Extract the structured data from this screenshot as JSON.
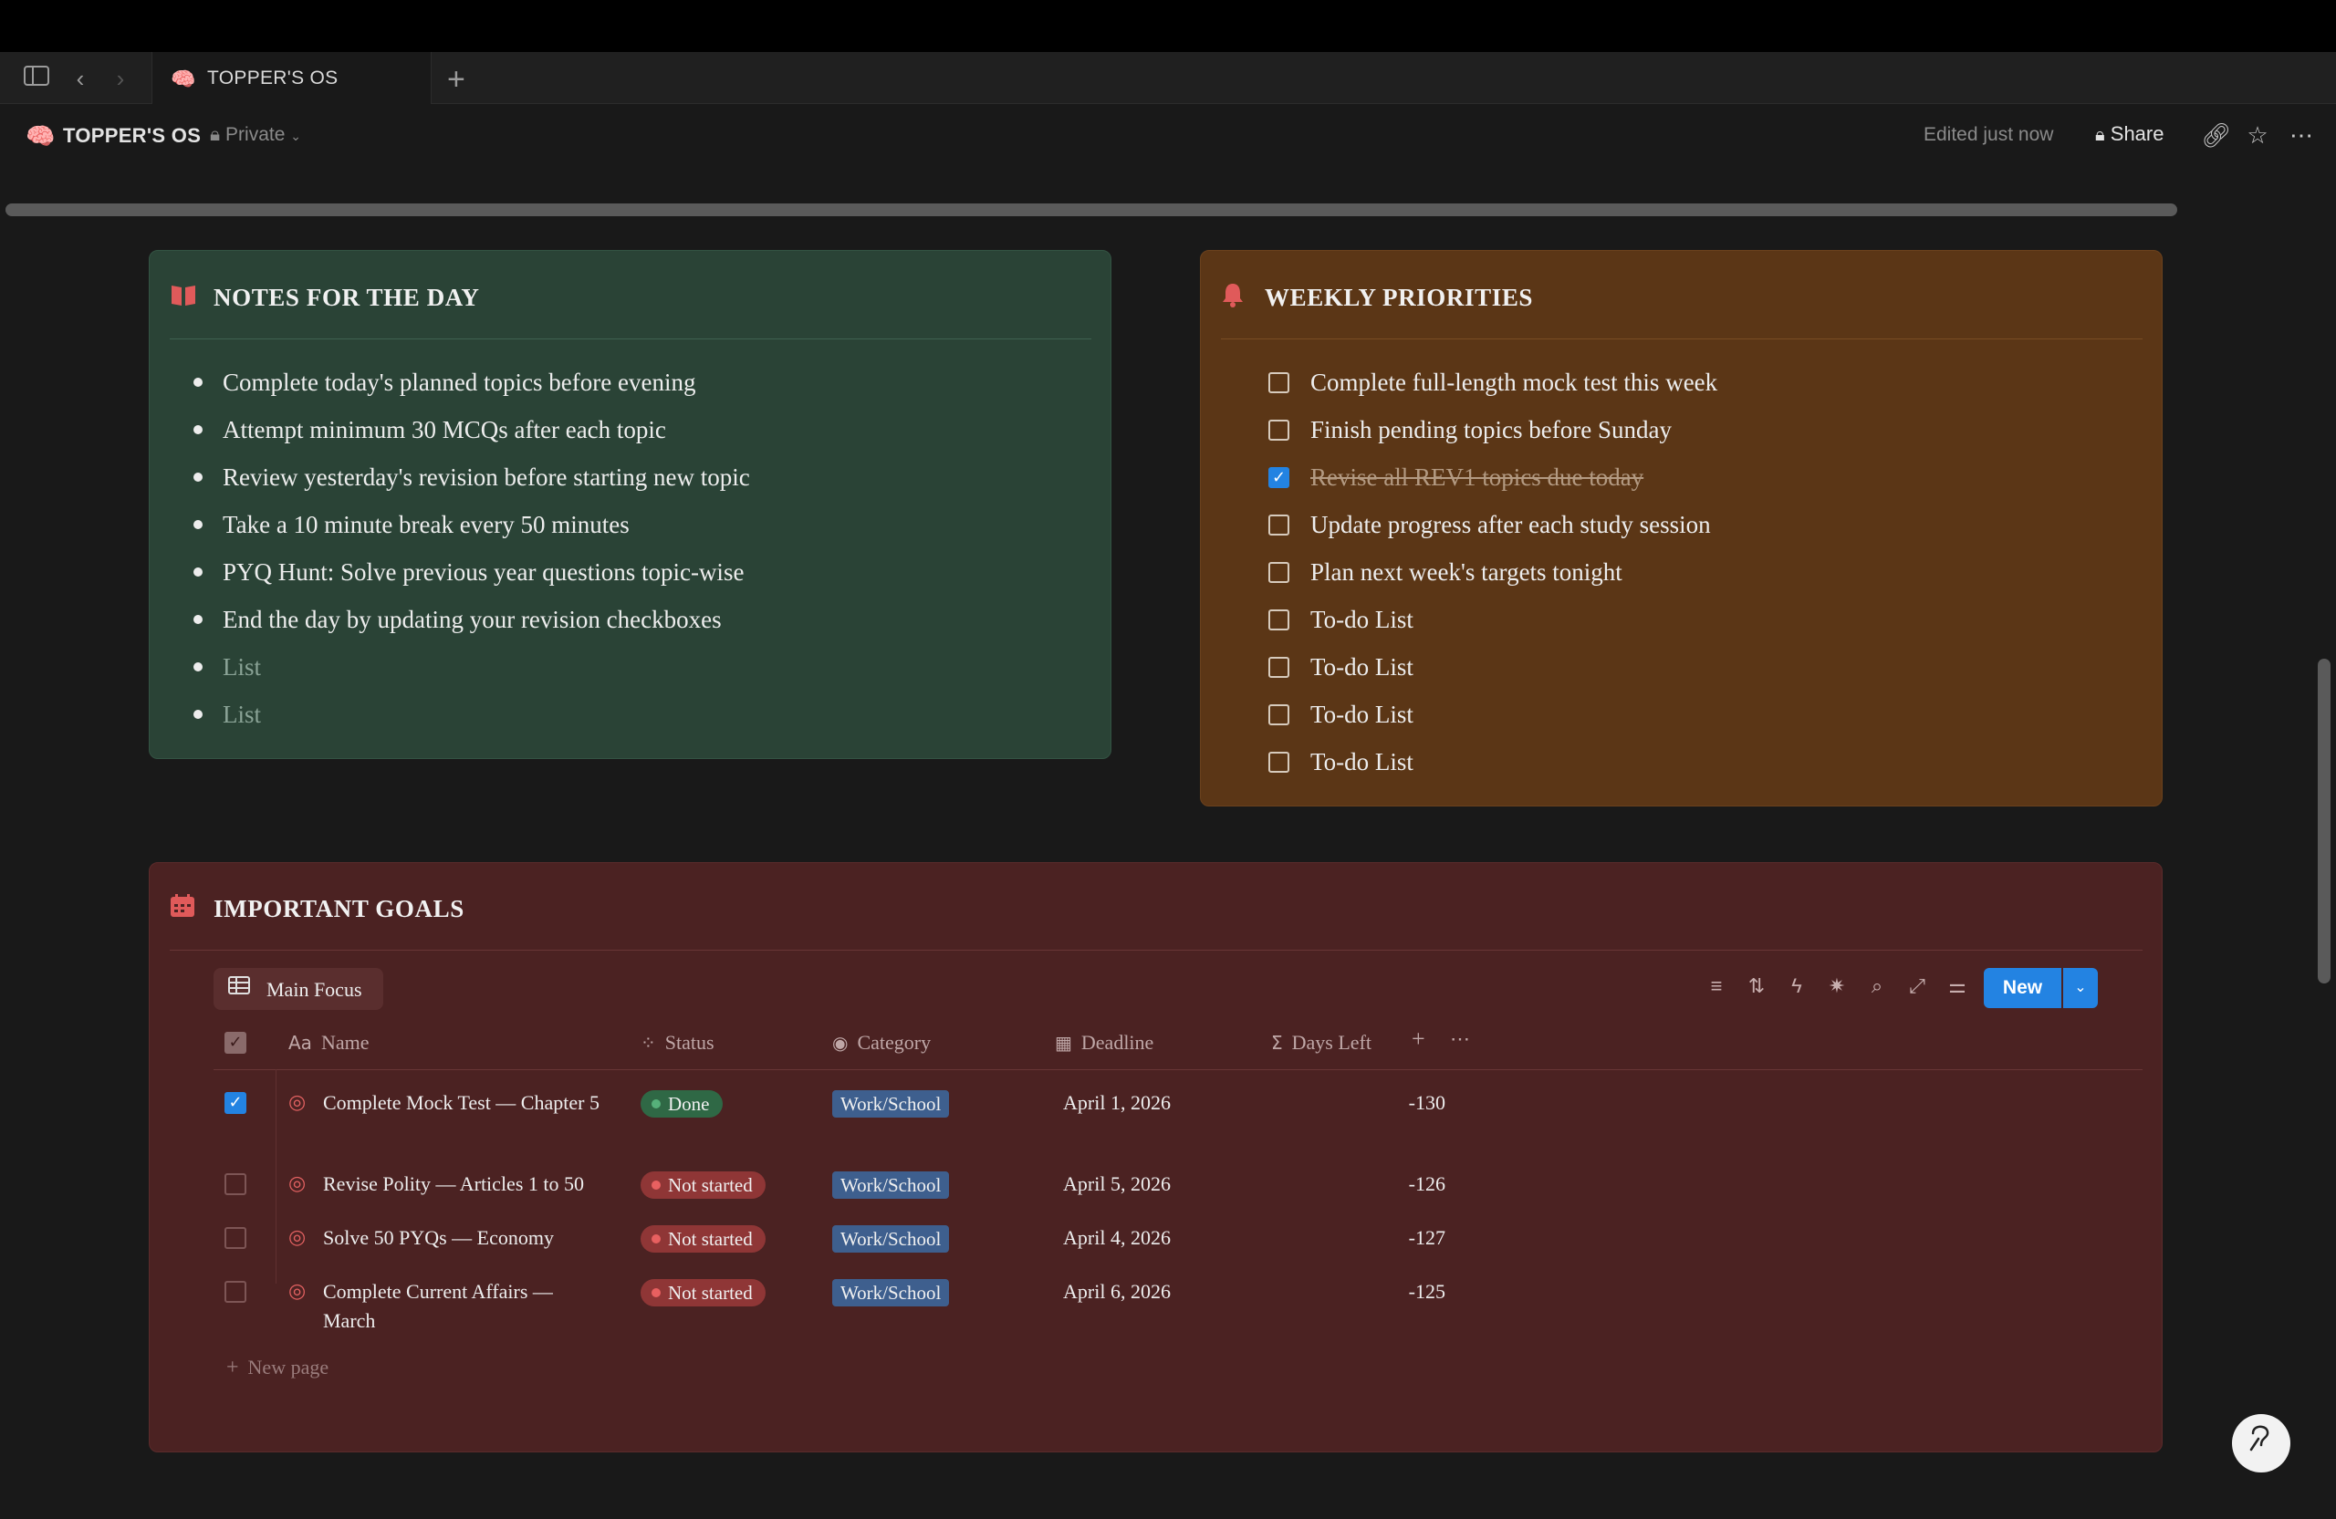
{
  "tabbar": {
    "tab_title": "TOPPER'S OS",
    "new_tab": "+"
  },
  "topbar": {
    "page_title": "TOPPER'S OS",
    "privacy": "Private",
    "edited": "Edited just now",
    "share_label": "Share"
  },
  "notes": {
    "title": "NOTES FOR THE DAY",
    "items": [
      "Complete today's planned topics before evening",
      "Attempt minimum 30 MCQs after each topic",
      "Review yesterday's revision before starting new topic",
      "Take a 10 minute break every 50 minutes",
      "PYQ Hunt: Solve previous year questions topic-wise",
      "End the day by updating your revision checkboxes",
      "List",
      "List"
    ]
  },
  "weekly": {
    "title": "WEEKLY PRIORITIES",
    "items": [
      {
        "label": "Complete full-length mock test this week",
        "checked": false
      },
      {
        "label": "Finish pending topics before Sunday",
        "checked": false
      },
      {
        "label": "Revise all REV1 topics due today",
        "checked": true
      },
      {
        "label": "Update progress after each study session",
        "checked": false
      },
      {
        "label": "Plan next week's targets tonight",
        "checked": false
      },
      {
        "label": "To-do List",
        "checked": false
      },
      {
        "label": "To-do List",
        "checked": false
      },
      {
        "label": "To-do List",
        "checked": false
      },
      {
        "label": "To-do List",
        "checked": false
      }
    ]
  },
  "goals": {
    "title": "IMPORTANT GOALS",
    "view_label": "Main Focus",
    "new_button": "New",
    "columns": {
      "name": "Name",
      "status": "Status",
      "category": "Category",
      "deadline": "Deadline",
      "days_left": "Days Left"
    },
    "rows": [
      {
        "name": "Complete Mock Test — Chapter 5",
        "status": "Done",
        "category": "Work/School",
        "deadline": "April 1, 2026",
        "days_left": "-130",
        "checked": true
      },
      {
        "name": "Revise Polity — Articles 1 to 50",
        "status": "Not started",
        "category": "Work/School",
        "deadline": "April 5, 2026",
        "days_left": "-126",
        "checked": false
      },
      {
        "name": "Solve 50 PYQs — Economy",
        "status": "Not started",
        "category": "Work/School",
        "deadline": "April 4, 2026",
        "days_left": "-127",
        "checked": false
      },
      {
        "name": "Complete Current Affairs — March",
        "status": "Not started",
        "category": "Work/School",
        "deadline": "April 6, 2026",
        "days_left": "-125",
        "checked": false
      }
    ],
    "new_page": "New page"
  },
  "icons": {
    "page_icon": "brain-icon",
    "notes_icon": "book-icon",
    "weekly_icon": "bell-icon",
    "goals_icon": "calendar-icon",
    "goal_row_icon": "target-icon"
  }
}
